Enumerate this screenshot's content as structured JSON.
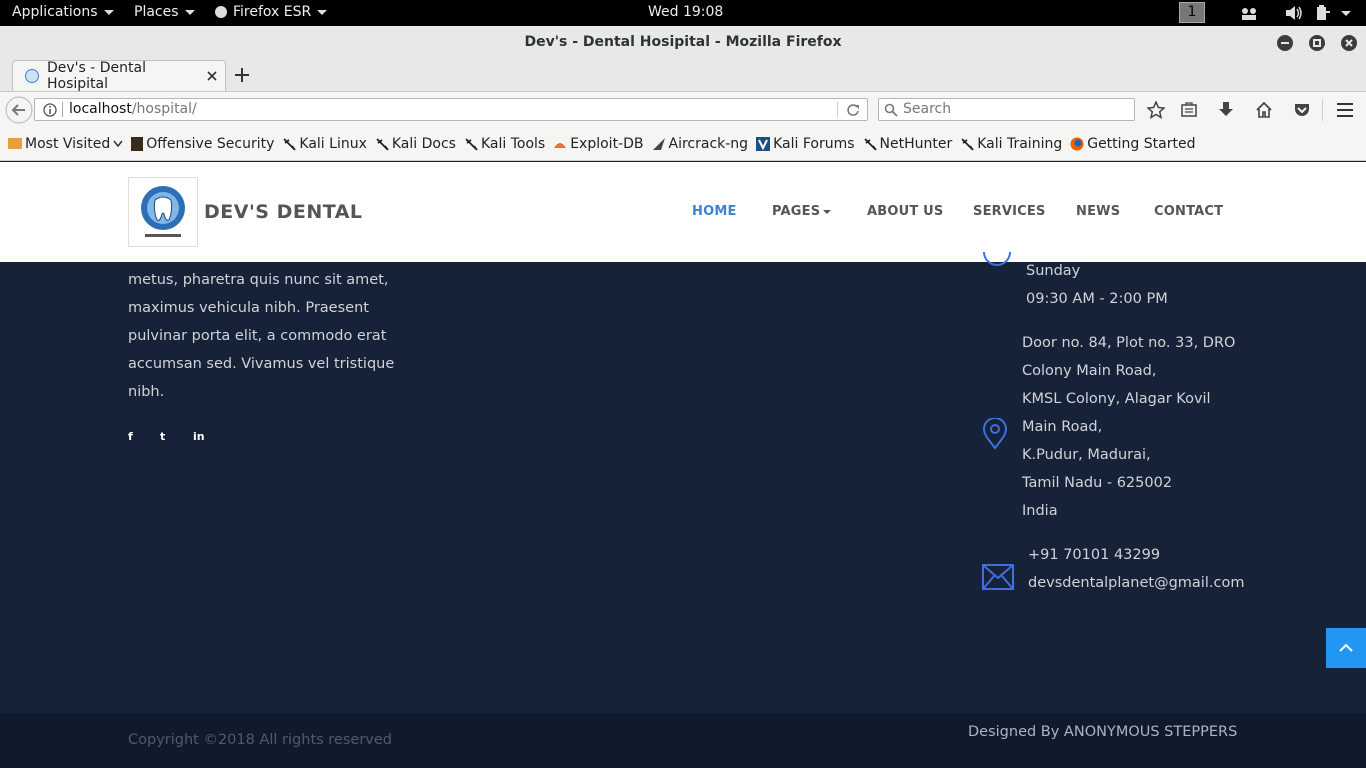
{
  "system_bar": {
    "applications": "Applications",
    "places": "Places",
    "firefox": "Firefox ESR",
    "clock": "Wed 19:08",
    "workspace": "1"
  },
  "window": {
    "title": "Dev's - Dental Hosipital - Mozilla Firefox"
  },
  "tab": {
    "title": "Dev's - Dental Hosipital"
  },
  "navbar": {
    "url_host": "localhost",
    "url_path": "/hospital/",
    "search_placeholder": "Search"
  },
  "bookmarks": [
    {
      "label": "Most Visited",
      "icon": "folder-icon"
    },
    {
      "label": "Offensive Security",
      "icon": "offsec-icon"
    },
    {
      "label": "Kali Linux",
      "icon": "kali-dragon-icon"
    },
    {
      "label": "Kali Docs",
      "icon": "kali-dragon-icon"
    },
    {
      "label": "Kali Tools",
      "icon": "kali-dragon-icon"
    },
    {
      "label": "Exploit-DB",
      "icon": "exploitdb-icon"
    },
    {
      "label": "Aircrack-ng",
      "icon": "aircrack-icon"
    },
    {
      "label": "Kali Forums",
      "icon": "kali-forums-icon"
    },
    {
      "label": "NetHunter",
      "icon": "kali-dragon-icon"
    },
    {
      "label": "Kali Training",
      "icon": "kali-dragon-icon"
    },
    {
      "label": "Getting Started",
      "icon": "firefox-icon"
    }
  ],
  "site": {
    "brand": "DEV'S DENTAL",
    "nav": [
      "HOME",
      "PAGES",
      "ABOUT US",
      "SERVICES",
      "NEWS",
      "CONTACT"
    ],
    "accent_color": "#3d82d6"
  },
  "footer": {
    "about_lines": [
      "metus, pharetra quis nunc sit amet,",
      "maximus vehicula nibh. Praesent",
      "pulvinar porta elit, a commodo erat",
      "accumsan sed. Vivamus vel tristique",
      "nibh."
    ],
    "social": [
      "f",
      "t",
      "in"
    ],
    "hours": [
      "Sunday",
      "09:30 AM - 2:00 PM"
    ],
    "address": [
      "Door no. 84, Plot no. 33, DRO",
      "Colony Main Road,",
      "KMSL Colony, Alagar Kovil",
      "Main Road,",
      "K.Pudur, Madurai,",
      "Tamil Nadu - 625002",
      "India"
    ],
    "phone": "+91 70101 43299",
    "email": "devsdentalplanet@gmail.com",
    "copyright": "Copyright ©2018 All rights reserved",
    "designed_by": "Designed By ANONYMOUS STEPPERS"
  }
}
